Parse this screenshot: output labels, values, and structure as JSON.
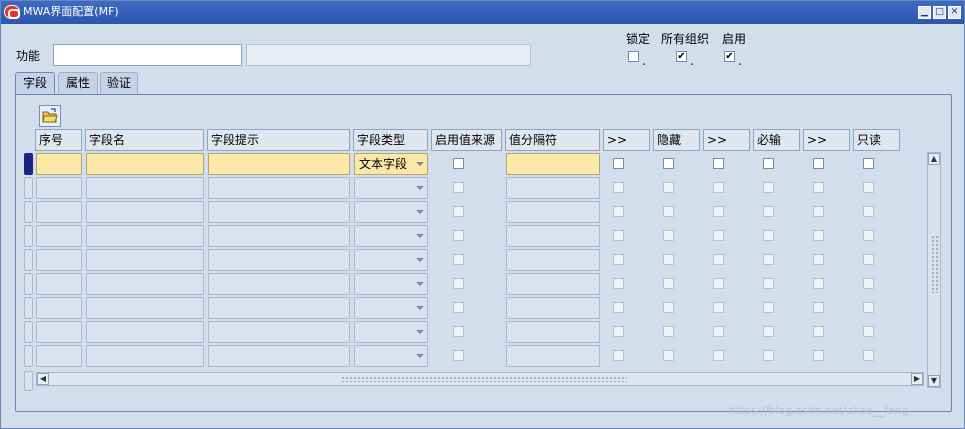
{
  "window": {
    "title": "MWA界面配置(MF)",
    "minimize": "▁",
    "maximize": "□",
    "close": "✕"
  },
  "header": {
    "function_label": "功能",
    "function_value": "",
    "function_desc": "",
    "lock_label": "锁定",
    "all_org_label": "所有组织",
    "enable_label": "启用",
    "lock_checked": false,
    "all_org_checked": true,
    "enable_checked": true
  },
  "tabs": [
    {
      "label": "字段",
      "active": true
    },
    {
      "label": "属性",
      "active": false
    },
    {
      "label": "验证",
      "active": false
    }
  ],
  "toolbar": {
    "open_icon": "folder-open-icon"
  },
  "columns": {
    "seq": "序号",
    "field_name": "字段名",
    "field_prompt": "字段提示",
    "field_type": "字段类型",
    "enable_value_source": "启用值来源",
    "value_separator": "值分隔符",
    "more1": ">>",
    "hidden": "隐藏",
    "more2": ">>",
    "required": "必输",
    "more3": ">>",
    "readonly": "只读"
  },
  "rows": [
    {
      "field_type": "文本字段"
    },
    {
      "field_type": ""
    },
    {
      "field_type": ""
    },
    {
      "field_type": ""
    },
    {
      "field_type": ""
    },
    {
      "field_type": ""
    },
    {
      "field_type": ""
    },
    {
      "field_type": ""
    },
    {
      "field_type": ""
    }
  ],
  "watermark": "https://blog.csdn.net/zhao__fang",
  "colors": {
    "titlebar": "#2a56ad",
    "background": "#d3deec",
    "current_cell": "#fbe8a7",
    "row_marker": "#1a237e"
  }
}
